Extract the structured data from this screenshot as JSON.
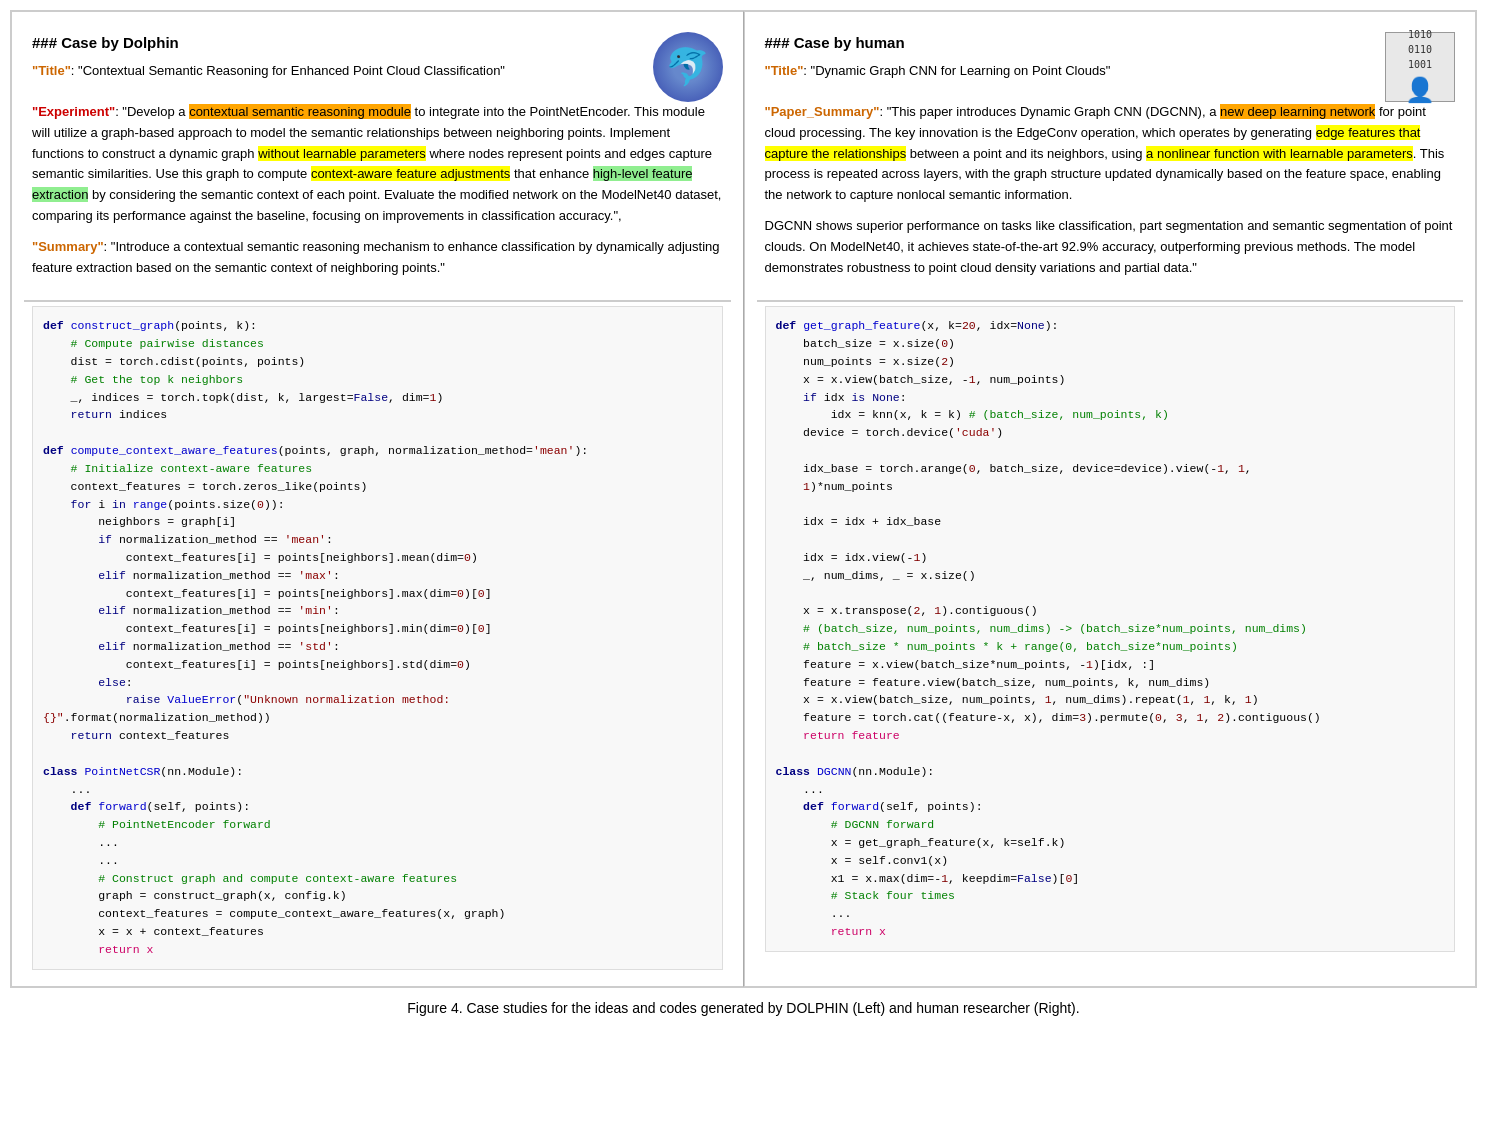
{
  "figure_caption": "Figure 4.  Case studies for the ideas and codes generated by DOLPHIN (Left) and human researcher (Right).",
  "left_panel": {
    "header": "### Case by Dolphin",
    "title_label": "\"Title\"",
    "title_value": "\"Contextual Semantic Reasoning for Enhanced Point Cloud Classification\"",
    "experiment_label": "\"Experiment\"",
    "experiment_text": ": \"Develop a contextual semantic reasoning module to integrate into the PointNetEncoder. This module will utilize a graph-based approach to model the semantic relationships between neighboring points. Implement functions to construct a dynamic graph without learnable parameters where nodes represent points and edges capture semantic similarities. Use this graph to compute context-aware feature adjustments that enhance high-level feature extraction by considering the semantic context of each point. Evaluate the modified network on the ModelNet40 dataset, comparing its performance against the baseline, focusing on improvements in classification accuracy.\",",
    "summary_label": "\"Summary\"",
    "summary_text": ": \"Introduce a contextual semantic reasoning mechanism to enhance classification by dynamically adjusting feature extraction based on the semantic context of neighboring points.\""
  },
  "right_panel": {
    "header": "### Case by human",
    "title_label": "\"Title\"",
    "title_value": "\"Dynamic Graph CNN for Learning on Point Clouds\"",
    "paper_summary_label": "\"Paper_Summary\"",
    "paper_summary_text": ": \"This paper introduces Dynamic Graph CNN (DGCNN), a new deep learning network for point cloud processing. The key innovation is the EdgeConv operation, which operates by generating edge features that capture the relationships between a point and its neighbors, using a nonlinear function with learnable parameters. This process is repeated across layers, with the graph structure updated dynamically based on the feature space, enabling the network to capture nonlocal semantic information.",
    "second_paragraph": "DGCNN shows superior performance on tasks like classification, part segmentation and semantic segmentation of point clouds. On ModelNet40, it achieves state-of-the-art 92.9% accuracy, outperforming previous methods. The model demonstrates robustness to point cloud density variations and partial data.\""
  }
}
